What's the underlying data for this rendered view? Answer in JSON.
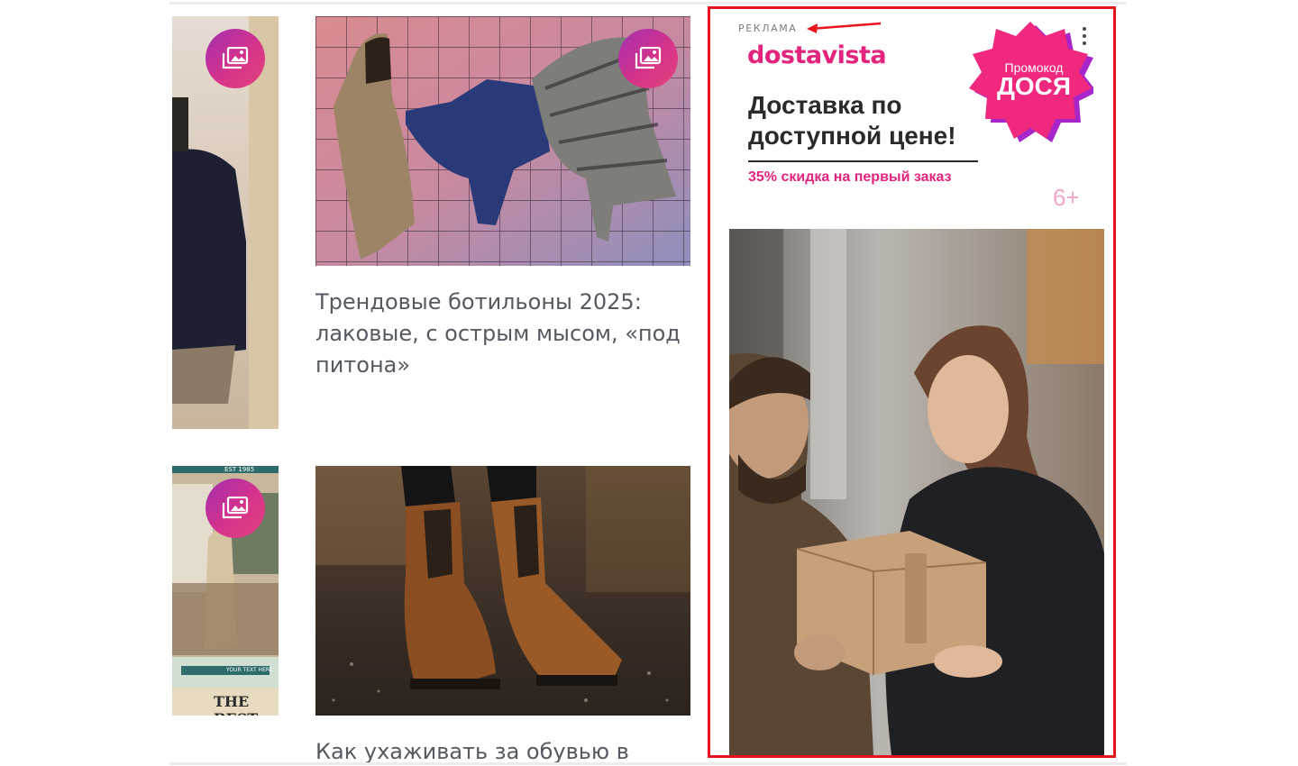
{
  "feed": {
    "articles": [
      {
        "title": "Трендовые ботильоны 2025: лаковые, с острым мысом, «под питона»"
      },
      {
        "title": "Как ухаживать за обувью в"
      }
    ],
    "side_thumb_text": {
      "est": "EST 1985",
      "your_text": "YOUR TEXT HERE",
      "best": "THE BEST"
    }
  },
  "ad": {
    "label": "РЕКЛАМА",
    "brand": "dostavista",
    "promo_caption": "Промокод",
    "promo_code": "ДОСЯ",
    "headline_line1": "Доставка по",
    "headline_line2": "доступной цене!",
    "subline": "35% скидка на первый заказ",
    "age_rating": "6+"
  },
  "colors": {
    "accent_pink": "#e3247f",
    "badge_purple": "#a02fb0",
    "highlight_frame": "#e8141d"
  },
  "icons": [
    "gallery-icon",
    "more-vertical-icon",
    "arrow-left-icon"
  ]
}
